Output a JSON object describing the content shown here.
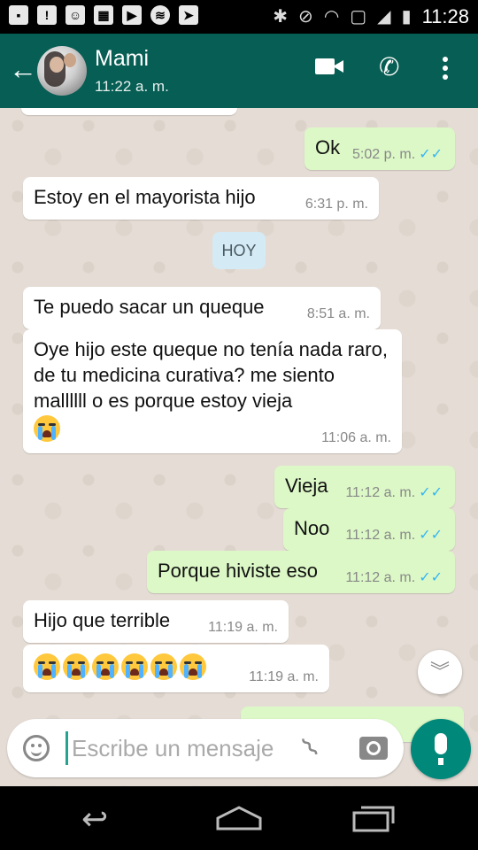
{
  "status_bar": {
    "time": "11:28",
    "left_icons": [
      "notification-icon",
      "warning-icon",
      "chat-icon",
      "photo-icon",
      "youtube-icon",
      "spotify-icon",
      "play-store-icon",
      "bluetooth-icon",
      "mute-icon",
      "wifi-icon",
      "signal-icon",
      "battery-icon"
    ]
  },
  "header": {
    "contact_name": "Mami",
    "last_seen": "11:22 a. m."
  },
  "date_chip": "HOY",
  "messages": [
    {
      "dir": "out",
      "text": "Ok",
      "time": "5:02 p. m.",
      "ticks": "✓✓"
    },
    {
      "dir": "in",
      "text": "Estoy  en el mayorista hijo",
      "time": "6:31 p. m."
    },
    {
      "dir": "in",
      "text": "Te puedo sacar un queque",
      "time": "8:51 a. m."
    },
    {
      "dir": "in",
      "text": "Oye hijo este queque  no tenía nada raro, de tu medicina curativa? me siento mallllll o es porque estoy  vieja",
      "time": "11:06 a. m.",
      "emoji_count": 1
    },
    {
      "dir": "out",
      "text": "Vieja",
      "time": "11:12 a. m.",
      "ticks": "✓✓"
    },
    {
      "dir": "out",
      "text": "Noo",
      "time": "11:12 a. m.",
      "ticks": "✓✓"
    },
    {
      "dir": "out",
      "text": "Porque hiviste eso",
      "time": "11:12 a. m.",
      "ticks": "✓✓"
    },
    {
      "dir": "in",
      "text": "Hijo que terrible",
      "time": "11:19 a. m."
    },
    {
      "dir": "in",
      "text": "",
      "time": "11:19 a. m.",
      "emoji_count": 6
    }
  ],
  "composer": {
    "placeholder": "Escribe un mensaje"
  },
  "colors": {
    "header": "#075e54",
    "chat_bg": "#e5ddd5",
    "out_bubble": "#dcf8c6",
    "in_bubble": "#ffffff",
    "mic": "#00897b",
    "ticks": "#34b7f1"
  }
}
